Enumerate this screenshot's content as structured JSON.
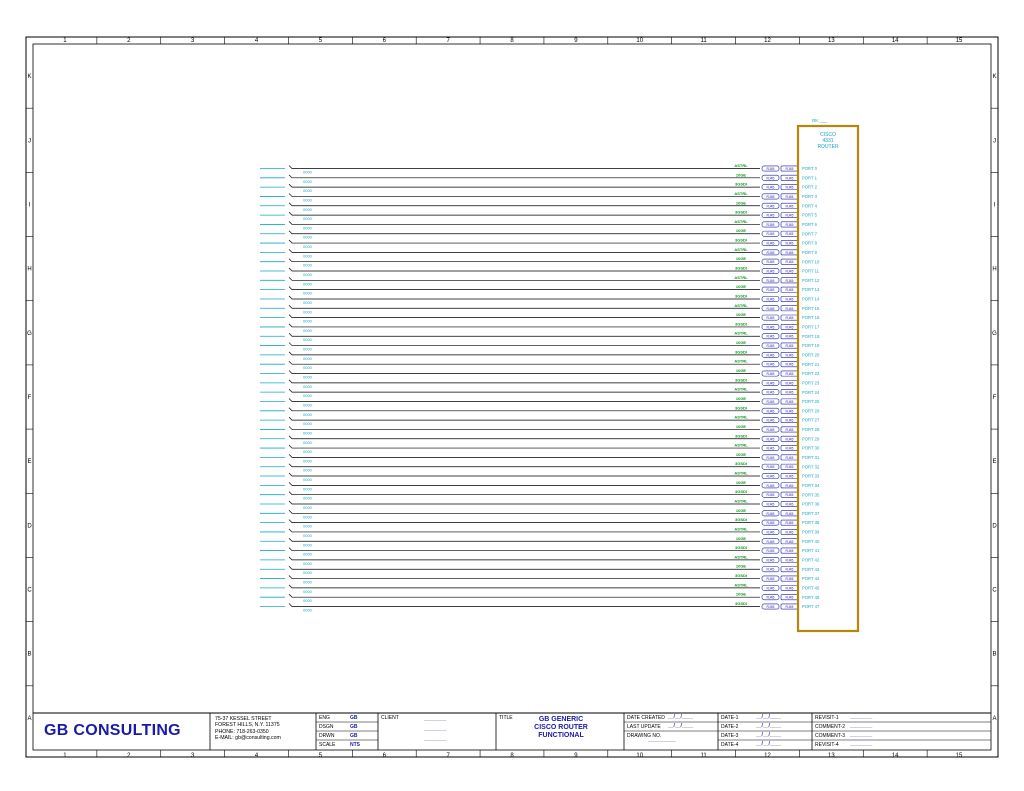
{
  "border": {
    "top_numbers": [
      "1",
      "2",
      "3",
      "4",
      "5",
      "6",
      "7",
      "8",
      "9",
      "10",
      "11",
      "12",
      "13",
      "14",
      "15"
    ],
    "side_letters": [
      "K",
      "J",
      "I",
      "H",
      "G",
      "F",
      "E",
      "D",
      "C",
      "B",
      "A"
    ]
  },
  "router": {
    "ref": "RK ___",
    "title_lines": [
      "CISCO",
      "4331",
      "ROUTER"
    ],
    "ports": [
      "PORT 0",
      "PORT 1",
      "PORT 2",
      "PORT 3",
      "PORT 4",
      "PORT 5",
      "PORT 6",
      "PORT 7",
      "PORT 8",
      "PORT 9",
      "PORT 10",
      "PORT 11",
      "PORT 12",
      "PORT 13",
      "PORT 14",
      "PORT 15",
      "PORT 16",
      "PORT 17",
      "PORT 18",
      "PORT 19",
      "PORT 20",
      "PORT 21",
      "PORT 22",
      "PORT 23",
      "PORT 24",
      "PORT 25",
      "PORT 26",
      "PORT 27",
      "PORT 28",
      "PORT 29",
      "PORT 30",
      "PORT 31",
      "PORT 32",
      "PORT 33",
      "PORT 34",
      "PORT 35",
      "PORT 36",
      "PORT 37",
      "PORT 38",
      "PORT 39",
      "PORT 40",
      "PORT 41",
      "PORT 42",
      "PORT 43",
      "PORT 44",
      "PORT 45",
      "PORT 46",
      "PORT 47"
    ]
  },
  "wire_labels": [
    "0000",
    "0000",
    "0000",
    "0000",
    "0000",
    "0000",
    "0000",
    "0000",
    "0000",
    "0000",
    "0000",
    "0000",
    "0000",
    "0000",
    "0000",
    "0000",
    "0000",
    "0000",
    "0000",
    "0000",
    "0000",
    "0000",
    "0000",
    "0000",
    "0000",
    "0000",
    "0000",
    "0000",
    "0000",
    "0000",
    "0000",
    "0000",
    "0000",
    "0000",
    "0000",
    "0000",
    "0000",
    "0000",
    "0000",
    "0000",
    "0000",
    "0000",
    "0000",
    "0000",
    "0000",
    "0000",
    "0000",
    "0000"
  ],
  "signal_labels": [
    "ASTRL",
    "10GE",
    "3GSDI",
    "ASTRL",
    "10GE",
    "3GSDI",
    "ASTRL",
    "10GE",
    "3GSDI",
    "ASTRL",
    "10GE",
    "3GSDI",
    "ASTRL",
    "10GE",
    "3GSDI",
    "ASTRL",
    "10GE",
    "3GSDI",
    "ASTRL",
    "10GE",
    "3GSDI",
    "ASTRL",
    "10GE",
    "3GSDI",
    "ASTRL",
    "10GE",
    "3GSDI",
    "ASTRL",
    "10GE",
    "3GSDI",
    "ASTRL",
    "10GE",
    "3GSDI",
    "ASTRL",
    "10GE",
    "3GSDI",
    "ASTRL",
    "10GE",
    "3GSDI",
    "ASTRL",
    "10GE",
    "3GSDI",
    "ASTRL",
    "10GE",
    "3GSDI",
    "ASTRL",
    "10GE",
    "3GSDI"
  ],
  "connector_labels": {
    "a": "RJ45",
    "b": "RJ45"
  },
  "title_block": {
    "company": "GB CONSULTING",
    "address_lines": [
      "75-37 KESSEL STREET",
      "FOREST HILLS, N.Y. 11375",
      "PHONE: 718-263-0350",
      "E-MAIL: gb@consulting.com"
    ],
    "role_rows": [
      {
        "label": "ENG",
        "value": "GB"
      },
      {
        "label": "DSGN",
        "value": "GB"
      },
      {
        "label": "DRWN",
        "value": "GB"
      },
      {
        "label": "SCALE",
        "value": "NTS"
      }
    ],
    "client_label": "CLIENT",
    "client_lines": [
      "________",
      "________",
      "________"
    ],
    "title_label": "TITLE",
    "title_lines": [
      "GB GENERIC",
      "CISCO ROUTER",
      "FUNCTIONAL"
    ],
    "date_rows": [
      {
        "label": "DATE CREATED",
        "value": "__/__/____"
      },
      {
        "label": "LAST UPDATE",
        "value": "__/__/____"
      },
      {
        "label": "DRAWING NO.",
        "value": "__________"
      }
    ],
    "rev_dates": [
      {
        "label": "DATE-1",
        "value": "__/__/____"
      },
      {
        "label": "DATE-2",
        "value": "__/__/____"
      },
      {
        "label": "DATE-3",
        "value": "__/__/____"
      },
      {
        "label": "DATE-4",
        "value": "__/__/____"
      }
    ],
    "revisions": [
      {
        "label": "REVISIT-1",
        "value": "________"
      },
      {
        "label": "COMMENT-2",
        "value": "________"
      },
      {
        "label": "COMMENT-3",
        "value": "________"
      },
      {
        "label": "REVISIT-4",
        "value": "________"
      }
    ]
  },
  "colors": {
    "ink": "#000000",
    "blue": "#1a1aa8",
    "cyan": "#15a8c8",
    "green": "#0a9a1a",
    "router_box": "#b8860b"
  }
}
